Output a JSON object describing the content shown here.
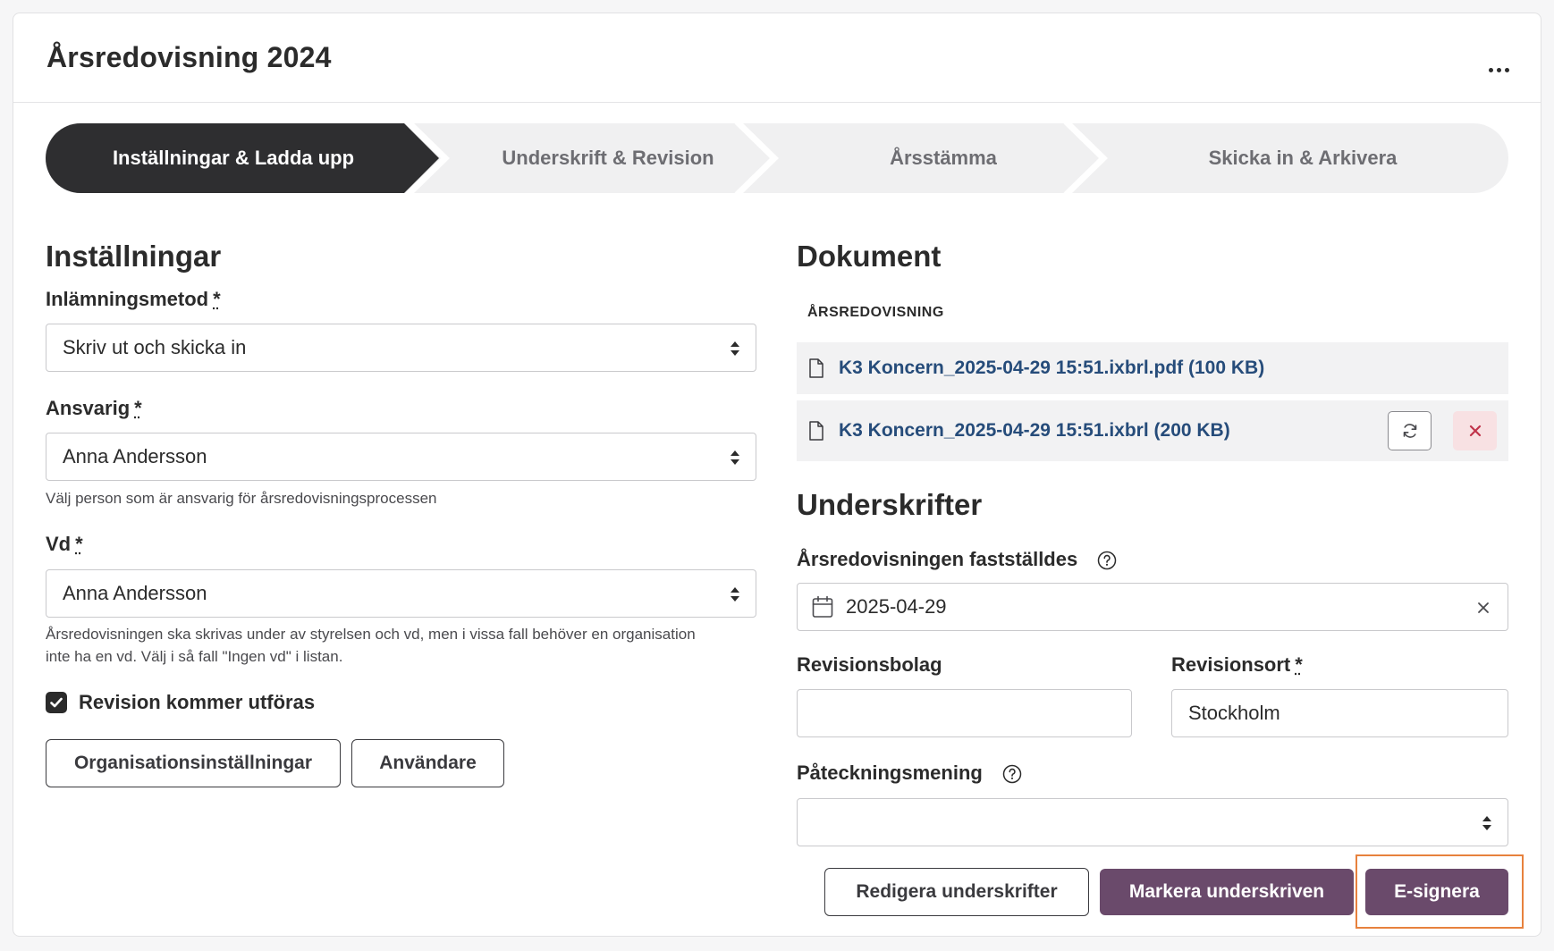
{
  "header": {
    "title": "Årsredovisning 2024",
    "more_icon": "more-horizontal-icon"
  },
  "stepper": {
    "steps": [
      {
        "label": "Inställningar & Ladda upp",
        "active": true
      },
      {
        "label": "Underskrift & Revision",
        "active": false
      },
      {
        "label": "Årsstämma",
        "active": false
      },
      {
        "label": "Skicka in & Arkivera",
        "active": false
      }
    ]
  },
  "settings": {
    "heading": "Inställningar",
    "submission_method": {
      "label": "Inlämningsmetod",
      "required_mark": "*",
      "value": "Skriv ut och skicka in"
    },
    "responsible": {
      "label": "Ansvarig",
      "required_mark": "*",
      "value": "Anna Andersson",
      "help": "Välj person som är ansvarig för årsredovisningsprocessen"
    },
    "ceo": {
      "label": "Vd",
      "required_mark": "*",
      "value": "Anna Andersson",
      "help_line1": "Årsredovisningen ska skrivas under av styrelsen och vd, men i vissa fall behöver en organisation",
      "help_line2": "inte ha en vd. Välj i så fall \"Ingen vd\" i listan."
    },
    "revision_checkbox": {
      "label": "Revision kommer utföras",
      "checked": true
    },
    "buttons": {
      "org_settings": "Organisationsinställningar",
      "users": "Användare"
    }
  },
  "documents": {
    "heading": "Dokument",
    "section_label": "ÅRSREDOVISNING",
    "files": [
      {
        "name": "K3 Koncern_2025-04-29 15:51.ixbrl.pdf (100 KB)"
      },
      {
        "name": "K3 Koncern_2025-04-29 15:51.ixbrl (200 KB)"
      }
    ]
  },
  "signatures": {
    "heading": "Underskrifter",
    "adopted_date": {
      "label": "Årsredovisningen fastställdes",
      "value": "2025-04-29"
    },
    "audit_firm": {
      "label": "Revisionsbolag",
      "value": ""
    },
    "audit_place": {
      "label": "Revisionsort",
      "required_mark": "*",
      "value": "Stockholm"
    },
    "endorsement": {
      "label": "Påteckningsmening",
      "value": ""
    },
    "buttons": {
      "edit": "Redigera underskrifter",
      "mark_signed": "Markera underskriven",
      "esign": "E-signera"
    }
  },
  "colors": {
    "primary": "#6a4a6b",
    "link": "#264c7a",
    "stepper_active": "#2e2e30",
    "highlight": "#e7813d",
    "delete_bg": "#f8e1e3",
    "delete_icon": "#c0334a"
  }
}
